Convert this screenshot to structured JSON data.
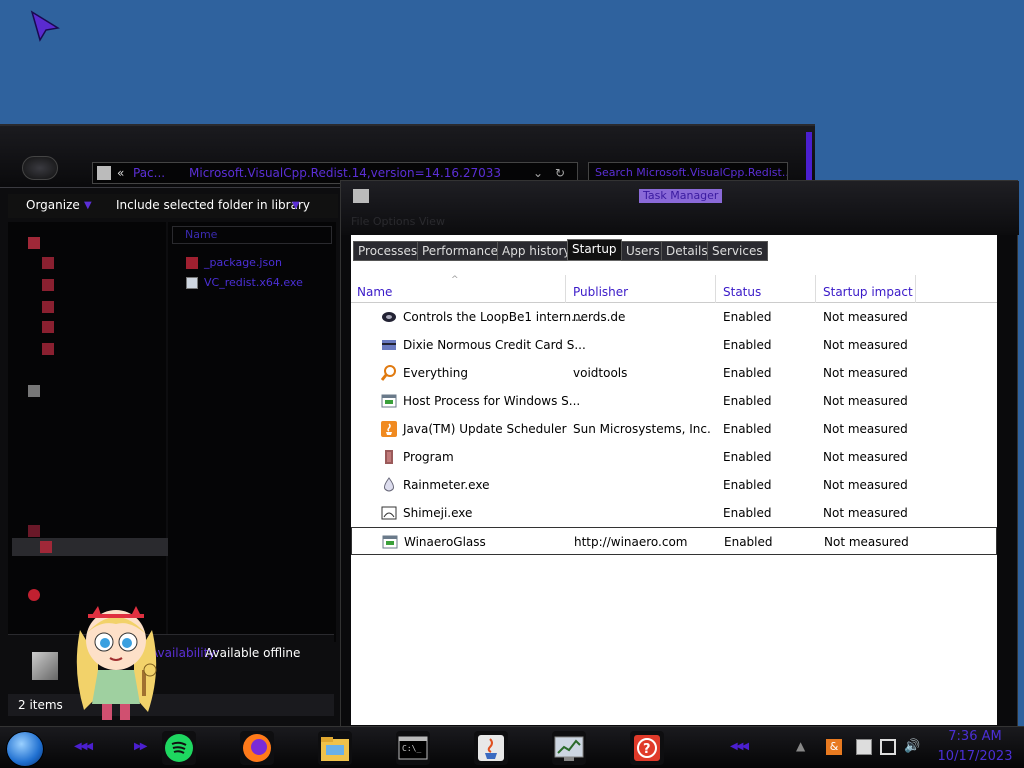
{
  "explorer": {
    "address": {
      "chevron": "«",
      "segment1": "Pac...",
      "segment2": "Microsoft.VisualCpp.Redist.14,version=14.16.27033",
      "search_placeholder": "Search Microsoft.VisualCpp.Redist..."
    },
    "toolbar": {
      "organize": "Organize",
      "include_library": "Include selected folder in library"
    },
    "column_name": "Name",
    "files": [
      "_package.json",
      "VC_redist.x64.exe"
    ],
    "details": {
      "availability_label": "Availability:",
      "availability_value": "Available offline"
    },
    "status": "2 items"
  },
  "taskmgr": {
    "title": "Task Manager",
    "menu": "File  Options  View",
    "tabs": [
      "Processes",
      "Performance",
      "App history",
      "Startup",
      "Users",
      "Details",
      "Services"
    ],
    "active_tab": "Startup",
    "columns": {
      "name": "Name",
      "publisher": "Publisher",
      "status": "Status",
      "impact": "Startup impact"
    },
    "rows": [
      {
        "name": "Controls the LoopBe1 intern...",
        "publisher": "nerds.de",
        "status": "Enabled",
        "impact": "Not measured",
        "icon": "loopbe-icon"
      },
      {
        "name": "Dixie Normous Credit Card S...",
        "publisher": "",
        "status": "Enabled",
        "impact": "Not measured",
        "icon": "credit-card-icon"
      },
      {
        "name": "Everything",
        "publisher": "voidtools",
        "status": "Enabled",
        "impact": "Not measured",
        "icon": "magnifier-icon"
      },
      {
        "name": "Host Process for Windows S...",
        "publisher": "",
        "status": "Enabled",
        "impact": "Not measured",
        "icon": "window-icon"
      },
      {
        "name": "Java(TM) Update Scheduler",
        "publisher": "Sun Microsystems, Inc.",
        "status": "Enabled",
        "impact": "Not measured",
        "icon": "java-icon"
      },
      {
        "name": "Program",
        "publisher": "",
        "status": "Enabled",
        "impact": "Not measured",
        "icon": "program-icon"
      },
      {
        "name": "Rainmeter.exe",
        "publisher": "",
        "status": "Enabled",
        "impact": "Not measured",
        "icon": "droplet-icon"
      },
      {
        "name": "Shimeji.exe",
        "publisher": "",
        "status": "Enabled",
        "impact": "Not measured",
        "icon": "shimeji-icon"
      },
      {
        "name": "WinaeroGlass",
        "publisher": "http://winaero.com",
        "status": "Enabled",
        "impact": "Not measured",
        "icon": "window-icon"
      }
    ],
    "selected_row": 8
  },
  "taskbar": {
    "time": "7:36 AM",
    "date": "10/17/2023",
    "tray_ampersand": "&"
  },
  "colors": {
    "accent_purple": "#5b2fd6",
    "desktop_blue": "#2f629e"
  }
}
